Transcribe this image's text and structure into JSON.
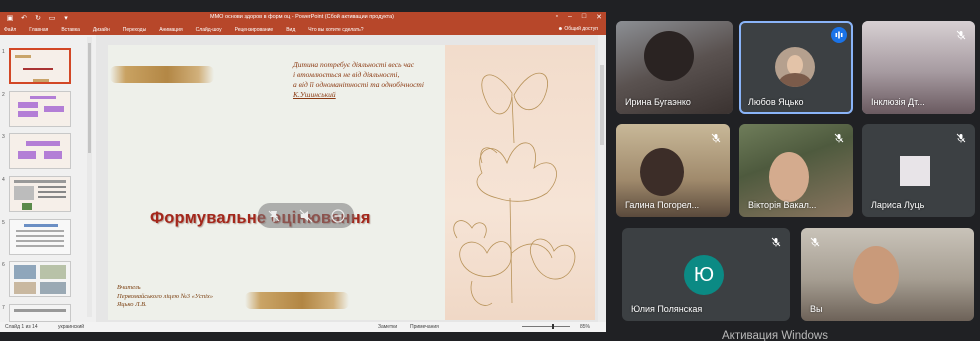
{
  "ppt": {
    "window_title": "ММО  основи здоров в форм оц - PowerPoint (Сбой активации продукта)",
    "menu": [
      "Файл",
      "Главная",
      "Вставка",
      "Дизайн",
      "Переходы",
      "Анимация",
      "Слайд-шоу",
      "Рецензирование",
      "Вид",
      "Что вы хотите сделать?"
    ],
    "share_label": "Общий доступ",
    "thumb_numbers": [
      "1",
      "2",
      "3",
      "4",
      "5",
      "6",
      "7"
    ],
    "slide": {
      "quote_lines": [
        "Дитина потребує діяльності весь час",
        "і втомлюється не від діяльності,",
        "а від її одноманітності та однобічності"
      ],
      "author": "К.Ушинський",
      "title": "Формувальне оцінювання",
      "teacher_lines": [
        "Вчитель",
        "Первомайського ліцею №3 «Успіх»",
        "Яцько Л.В."
      ]
    },
    "status": {
      "slide_count": "Слайд 1 из 14",
      "language": "украинский",
      "notes": "Заметки",
      "comments": "Примечания",
      "zoom": "85%"
    }
  },
  "participants": [
    {
      "name": "Ирина Бугаэнко",
      "muted": false
    },
    {
      "name": "Любов Яцько",
      "muted": false,
      "speaking": true
    },
    {
      "name": "Інклюзія Дт...",
      "muted": true
    },
    {
      "name": "Галина Погорел...",
      "muted": true
    },
    {
      "name": "Вікторія Вакал...",
      "muted": true
    },
    {
      "name": "Лариса Луць",
      "muted": true
    },
    {
      "name": "Юлия Полянская",
      "muted": true,
      "initial": "Ю"
    },
    {
      "name": "Вы",
      "muted": true
    }
  ],
  "watermark": "Активация Windows",
  "colors": {
    "ppt_accent": "#b7472a",
    "meet_bg": "#202124",
    "tile_bg": "#3c4043",
    "active_speaker": "#8ab4f8",
    "avatar_teal": "#0b8a84"
  }
}
